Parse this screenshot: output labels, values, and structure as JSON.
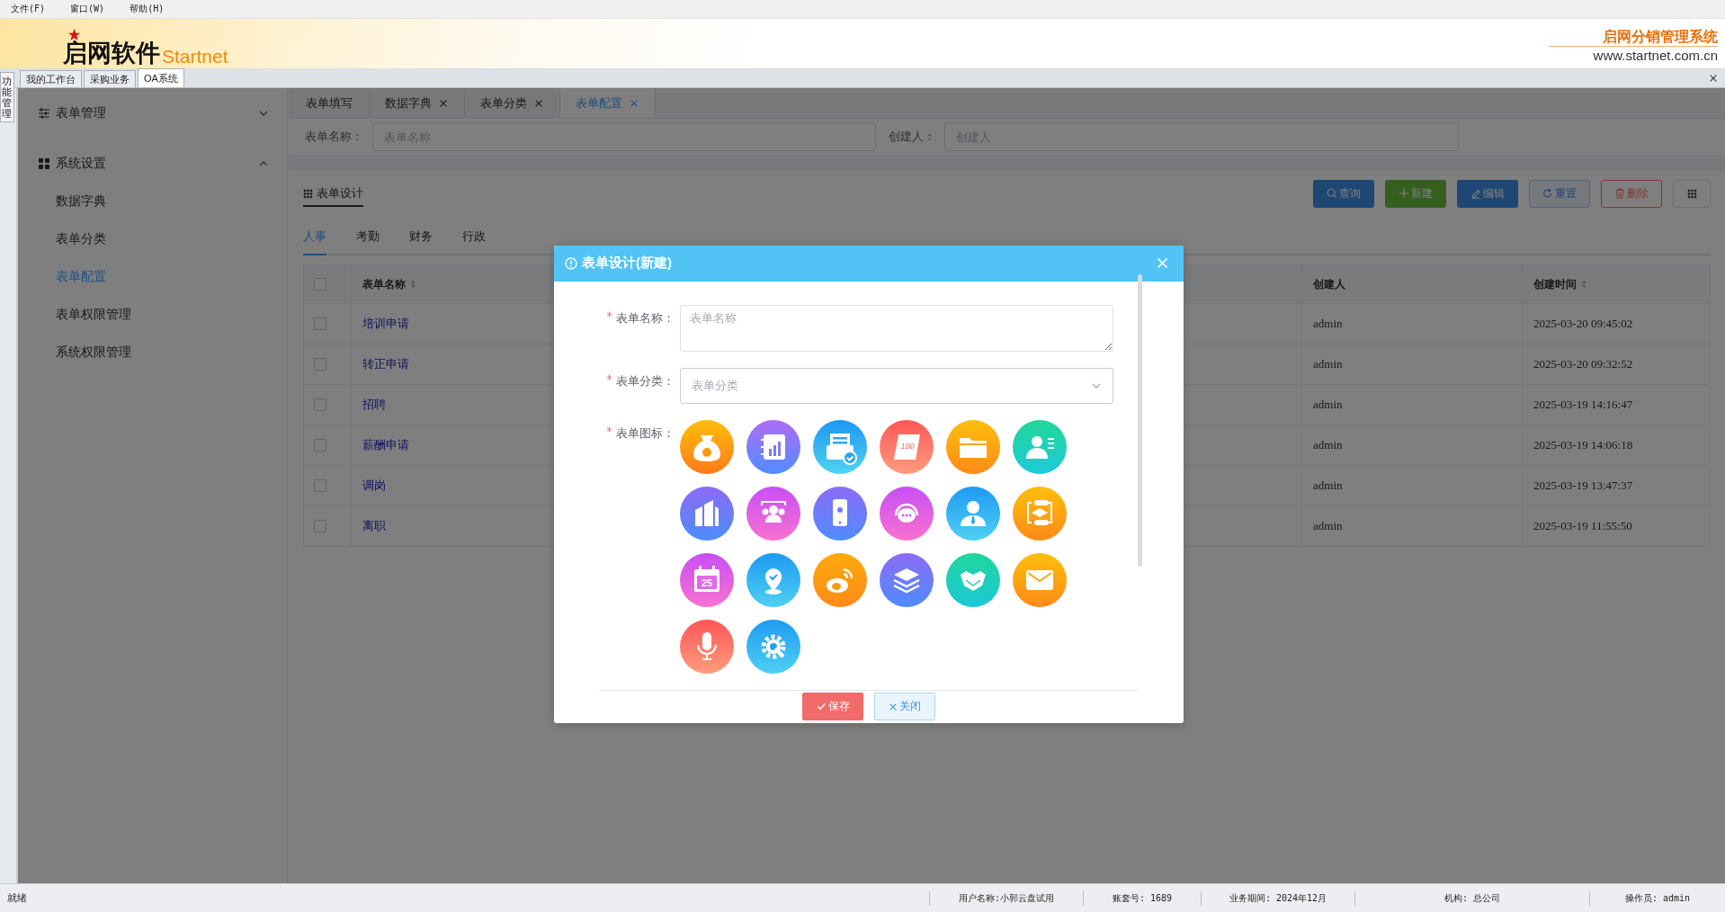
{
  "menu_bar": [
    "文件(F)",
    "窗口(W)",
    "帮助(H)"
  ],
  "header": {
    "logo_cn": "启网软件",
    "logo_en": "Startnet",
    "system_name": "启网分销管理系统",
    "website": "www.startnet.com.cn"
  },
  "side_tab": "功能管理",
  "workspace_tabs": [
    {
      "label": "我的工作台",
      "selected": false
    },
    {
      "label": "采购业务",
      "selected": false
    },
    {
      "label": "OA系统",
      "selected": true
    }
  ],
  "sidebar": {
    "groups": [
      {
        "label": "表单管理",
        "expanded": false
      },
      {
        "label": "系统设置",
        "expanded": true,
        "children": [
          {
            "label": "数据字典",
            "selected": false
          },
          {
            "label": "表单分类",
            "selected": false
          },
          {
            "label": "表单配置",
            "selected": true
          },
          {
            "label": "表单权限管理",
            "selected": false
          },
          {
            "label": "系统权限管理",
            "selected": false
          }
        ]
      }
    ]
  },
  "page_tabs": [
    {
      "label": "表单填写",
      "closable": false,
      "selected": false
    },
    {
      "label": "数据字典",
      "closable": true,
      "selected": false
    },
    {
      "label": "表单分类",
      "closable": true,
      "selected": false
    },
    {
      "label": "表单配置",
      "closable": true,
      "selected": true
    }
  ],
  "search": {
    "fields": [
      {
        "label": "表单名称：",
        "placeholder": "表单名称"
      },
      {
        "label": "创建人：",
        "placeholder": "创建人"
      }
    ]
  },
  "card": {
    "title": "表单设计",
    "buttons": [
      {
        "label": "查询",
        "kind": "query"
      },
      {
        "label": "新建",
        "kind": "create"
      },
      {
        "label": "编辑",
        "kind": "edit"
      },
      {
        "label": "重置",
        "kind": "reset"
      },
      {
        "label": "删除",
        "kind": "delete"
      },
      {
        "kind": "columns"
      }
    ]
  },
  "category_tabs": [
    {
      "label": "人事",
      "selected": true
    },
    {
      "label": "考勤",
      "selected": false
    },
    {
      "label": "财务",
      "selected": false
    },
    {
      "label": "行政",
      "selected": false
    }
  ],
  "table": {
    "all_checked": false,
    "columns": [
      {
        "label": "表单名称",
        "sortable": true
      },
      {
        "label": "创建人",
        "sortable": false
      },
      {
        "label": "创建时间",
        "sortable": true
      }
    ],
    "rows": [
      {
        "checked": false,
        "name": "培训申请",
        "creator": "admin",
        "created": "2025-03-20 09:45:02"
      },
      {
        "checked": false,
        "name": "转正申请",
        "creator": "admin",
        "created": "2025-03-20 09:32:52"
      },
      {
        "checked": false,
        "name": "招聘",
        "creator": "admin",
        "created": "2025-03-19 14:16:47"
      },
      {
        "checked": false,
        "name": "薪酬申请",
        "creator": "admin",
        "created": "2025-03-19 14:06:18"
      },
      {
        "checked": false,
        "name": "调岗",
        "creator": "admin",
        "created": "2025-03-19 13:47:37"
      },
      {
        "checked": false,
        "name": "离职",
        "creator": "admin",
        "created": "2025-03-19 11:55:50"
      }
    ]
  },
  "dialog": {
    "title": "表单设计(新建)",
    "fields": [
      {
        "kind": "textarea",
        "label": "表单名称：",
        "required": true,
        "placeholder": "表单名称"
      },
      {
        "kind": "select",
        "label": "表单分类：",
        "required": true,
        "placeholder": "表单分类"
      },
      {
        "kind": "icons",
        "label": "表单图标：",
        "required": true,
        "marks": [
          "100",
          "25"
        ]
      }
    ],
    "buttons": [
      {
        "label": "保存",
        "kind": "primary"
      },
      {
        "label": "关闭",
        "kind": "secondary"
      }
    ]
  },
  "status_bar": {
    "status": "就绪",
    "fields": [
      "用户名称:小郭云盘试用",
      "账套号: 1689",
      "业务期间: 2024年12月",
      "机构: 总公司",
      "操作员: admin"
    ]
  }
}
